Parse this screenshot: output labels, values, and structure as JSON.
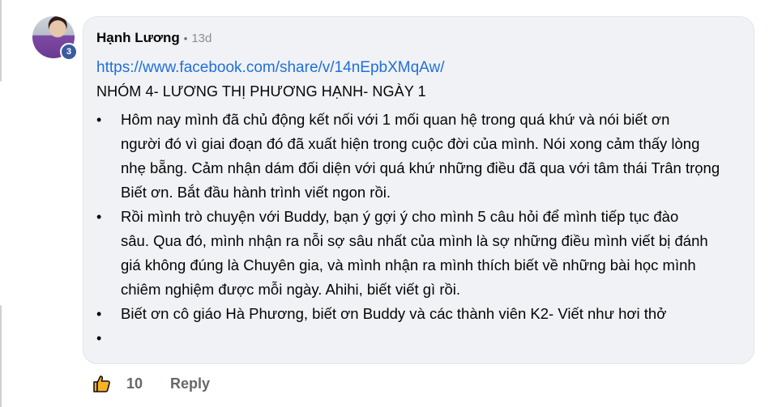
{
  "comment": {
    "author": "Hạnh Lương",
    "separator": "•",
    "time_ago": "13d",
    "avatar_badge": "3",
    "link": "https://www.facebook.com/share/v/14nEpbXMqAw/",
    "title": "NHÓM 4- LƯƠNG THỊ PHƯƠNG HẠNH- NGÀY 1",
    "bullet_symbol": "•",
    "lines": [
      {
        "bullet": true,
        "text": "Hôm nay mình đã chủ động kết nối với 1 mối quan hệ trong quá khứ và nói biết ơn"
      },
      {
        "bullet": false,
        "text": "người đó vì giai đoạn đó đã xuất hiện trong cuộc đời của mình. Nói xong cảm thấy lòng"
      },
      {
        "bullet": false,
        "text": "nhẹ bẵng. Cảm nhận dám đối diện với quá khứ những điều đã qua với tâm thái Trân trọng"
      },
      {
        "bullet": false,
        "text": "Biết ơn. Bắt đầu hành trình viết ngon rồi."
      },
      {
        "bullet": true,
        "text": "Rồi mình trò chuyện với Buddy, bạn ý gợi ý cho mình 5 câu hỏi để mình tiếp tục đào"
      },
      {
        "bullet": false,
        "text": "sâu. Qua đó, mình nhận ra nỗi sợ sâu nhất của mình là sợ những điều mình viết bị đánh"
      },
      {
        "bullet": false,
        "text": "giá không đúng là Chuyên gia, và mình nhận ra mình thích biết về những bài học mình"
      },
      {
        "bullet": false,
        "text": "chiêm nghiệm được mỗi ngày. Ahihi, biết viết gì rồi."
      },
      {
        "bullet": true,
        "text": "Biết ơn cô giáo Hà Phương, biết ơn Buddy và các thành viên K2- Viết như hơi thở"
      },
      {
        "bullet": true,
        "text": ""
      }
    ]
  },
  "actions": {
    "like_icon": "thumbs-up-icon",
    "like_color": "#f7b125",
    "like_count": "10",
    "reply_label": "Reply"
  }
}
